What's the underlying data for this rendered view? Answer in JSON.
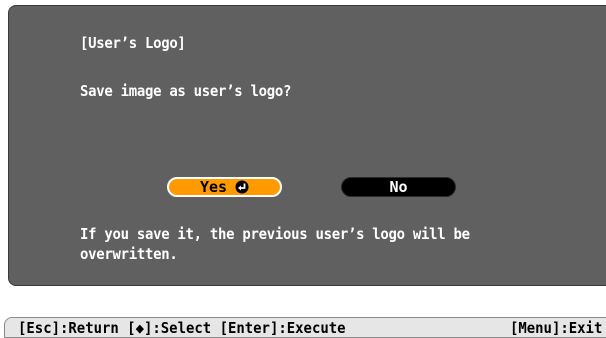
{
  "dialog": {
    "title": "[User’s Logo]",
    "question": "Save image as user’s logo?",
    "info": "If you save it, the previous user’s logo will be\noverwritten."
  },
  "buttons": {
    "yes": "Yes",
    "no": "No"
  },
  "statusbar": {
    "left": "[Esc]:Return [◆]:Select [Enter]:Execute",
    "right": "[Menu]:Exit"
  },
  "colors": {
    "dialog_bg": "#606060",
    "yes_bg": "#ff9a00",
    "no_bg": "#000000",
    "statusbar_bg": "#e6e6e6"
  },
  "icons": {
    "yes_icon": "enter-icon"
  }
}
